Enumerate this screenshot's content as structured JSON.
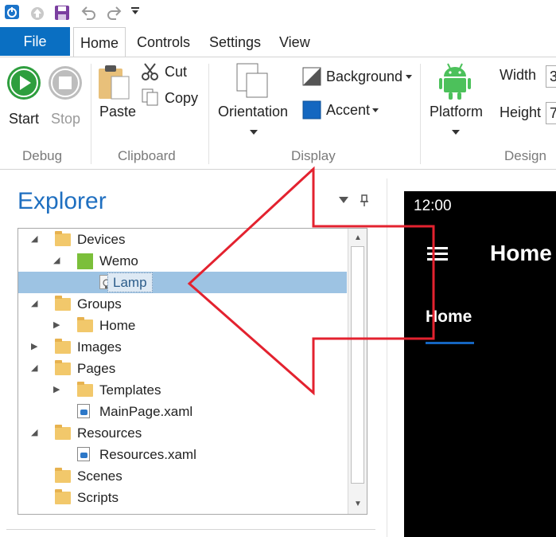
{
  "tabs": {
    "file": "File",
    "home": "Home",
    "controls": "Controls",
    "settings": "Settings",
    "view": "View"
  },
  "ribbon": {
    "start": "Start",
    "stop": "Stop",
    "paste": "Paste",
    "cut": "Cut",
    "copy": "Copy",
    "orientation": "Orientation",
    "background": "Background",
    "accent": "Accent",
    "platform": "Platform",
    "width": "Width",
    "height": "Height",
    "width_value": "3",
    "height_value": "7",
    "groups": {
      "debug": "Debug",
      "clipboard": "Clipboard",
      "display": "Display",
      "design": "Design"
    }
  },
  "explorer": {
    "title": "Explorer",
    "items": [
      {
        "label": "Devices",
        "depth": 0,
        "expander": "expanded",
        "icon": "folder-open-icon"
      },
      {
        "label": "Wemo",
        "depth": 1,
        "expander": "expanded",
        "icon": "wemo-logo-icon"
      },
      {
        "label": "Lamp",
        "depth": 2,
        "expander": "none",
        "icon": "lightbulb-icon",
        "selected": true
      },
      {
        "label": "Groups",
        "depth": 0,
        "expander": "expanded",
        "icon": "folder-open-icon"
      },
      {
        "label": "Home",
        "depth": 1,
        "expander": "collapsed",
        "icon": "folder-icon"
      },
      {
        "label": "Images",
        "depth": 0,
        "expander": "collapsed",
        "icon": "folder-icon"
      },
      {
        "label": "Pages",
        "depth": 0,
        "expander": "expanded",
        "icon": "folder-open-icon"
      },
      {
        "label": "Templates",
        "depth": 1,
        "expander": "collapsed",
        "icon": "folder-icon"
      },
      {
        "label": "MainPage.xaml",
        "depth": 1,
        "expander": "none",
        "icon": "xaml-file-icon"
      },
      {
        "label": "Resources",
        "depth": 0,
        "expander": "expanded",
        "icon": "folder-open-icon"
      },
      {
        "label": "Resources.xaml",
        "depth": 1,
        "expander": "none",
        "icon": "xaml-file-icon"
      },
      {
        "label": "Scenes",
        "depth": 0,
        "expander": "none",
        "icon": "folder-icon"
      },
      {
        "label": "Scripts",
        "depth": 0,
        "expander": "none",
        "icon": "folder-icon"
      }
    ]
  },
  "preview": {
    "time": "12:00",
    "header_title": "Home",
    "tab_label": "Home",
    "accent_color": "#1565c0",
    "background_color": "#000000"
  },
  "colors": {
    "file_tab": "#0a6fc2",
    "selection": "#9dc3e3",
    "arrow": "#e3222f",
    "start_button": "#2e9e3e",
    "android": "#4cc15b"
  }
}
